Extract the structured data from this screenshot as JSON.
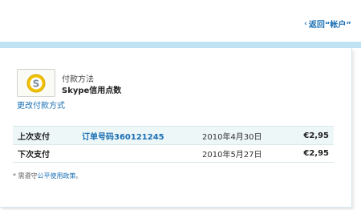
{
  "header": {
    "back_label": "返回“帐户”",
    "back_chevron": "‹"
  },
  "payment_method": {
    "title": "付款方法",
    "value": "Skype信用点数",
    "change_link": "更改付款方式",
    "icon": "skype-credit-icon",
    "icon_colors": {
      "ring": "#f2c200",
      "inner": "#ffffff",
      "letter": "#7a8a99"
    }
  },
  "payments": [
    {
      "label": "上次支付",
      "order": "订单号码360121245",
      "date": "2010年4月30日",
      "amount": "€2,95"
    },
    {
      "label": "下次支付",
      "order": "",
      "date": "2010年5月27日",
      "amount": "€2,95"
    }
  ],
  "footnote": {
    "prefix": "* 需遵守",
    "link": "公平使用政策",
    "suffix": "。"
  },
  "colors": {
    "accent": "#1a6fb4",
    "top_bar": "#bfe3f4",
    "row_highlight": "#eef7f8"
  }
}
